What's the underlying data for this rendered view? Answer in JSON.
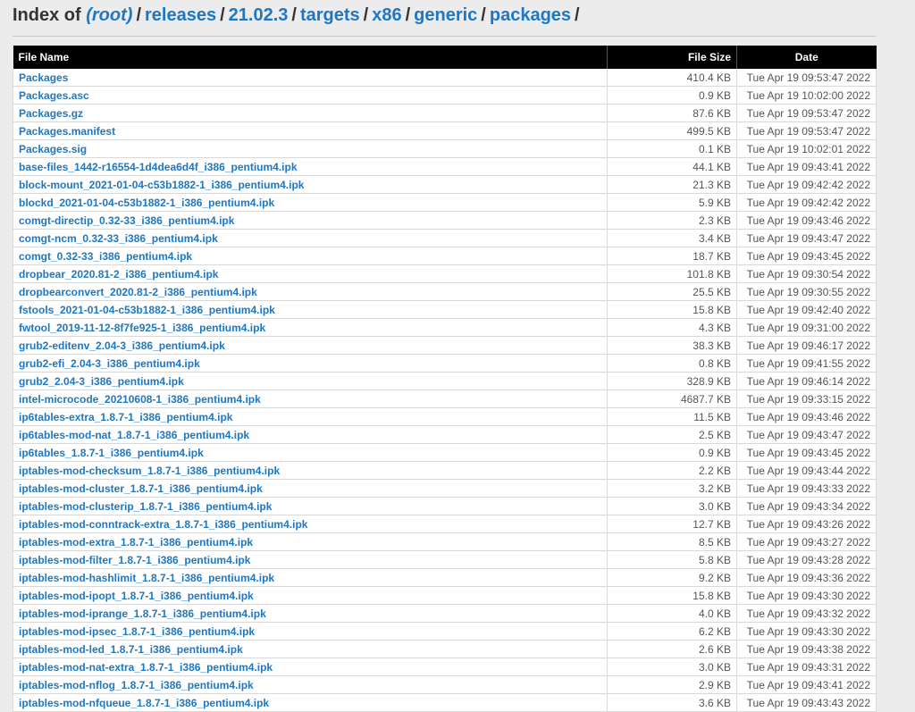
{
  "heading": {
    "prefix": "Index of ",
    "breadcrumb": [
      "(root)",
      "releases",
      "21.02.3",
      "targets",
      "x86",
      "generic",
      "packages"
    ],
    "trailing": "/"
  },
  "table": {
    "columns": [
      "File Name",
      "File Size",
      "Date"
    ],
    "rows": [
      {
        "name": "Packages",
        "size": "410.4 KB",
        "date": "Tue Apr 19 09:53:47 2022"
      },
      {
        "name": "Packages.asc",
        "size": "0.9 KB",
        "date": "Tue Apr 19 10:02:00 2022"
      },
      {
        "name": "Packages.gz",
        "size": "87.6 KB",
        "date": "Tue Apr 19 09:53:47 2022"
      },
      {
        "name": "Packages.manifest",
        "size": "499.5 KB",
        "date": "Tue Apr 19 09:53:47 2022"
      },
      {
        "name": "Packages.sig",
        "size": "0.1 KB",
        "date": "Tue Apr 19 10:02:01 2022"
      },
      {
        "name": "base-files_1442-r16554-1d4dea6d4f_i386_pentium4.ipk",
        "size": "44.1 KB",
        "date": "Tue Apr 19 09:43:41 2022"
      },
      {
        "name": "block-mount_2021-01-04-c53b1882-1_i386_pentium4.ipk",
        "size": "21.3 KB",
        "date": "Tue Apr 19 09:42:42 2022"
      },
      {
        "name": "blockd_2021-01-04-c53b1882-1_i386_pentium4.ipk",
        "size": "5.9 KB",
        "date": "Tue Apr 19 09:42:42 2022"
      },
      {
        "name": "comgt-directip_0.32-33_i386_pentium4.ipk",
        "size": "2.3 KB",
        "date": "Tue Apr 19 09:43:46 2022"
      },
      {
        "name": "comgt-ncm_0.32-33_i386_pentium4.ipk",
        "size": "3.4 KB",
        "date": "Tue Apr 19 09:43:47 2022"
      },
      {
        "name": "comgt_0.32-33_i386_pentium4.ipk",
        "size": "18.7 KB",
        "date": "Tue Apr 19 09:43:45 2022"
      },
      {
        "name": "dropbear_2020.81-2_i386_pentium4.ipk",
        "size": "101.8 KB",
        "date": "Tue Apr 19 09:30:54 2022"
      },
      {
        "name": "dropbearconvert_2020.81-2_i386_pentium4.ipk",
        "size": "25.5 KB",
        "date": "Tue Apr 19 09:30:55 2022"
      },
      {
        "name": "fstools_2021-01-04-c53b1882-1_i386_pentium4.ipk",
        "size": "15.8 KB",
        "date": "Tue Apr 19 09:42:40 2022"
      },
      {
        "name": "fwtool_2019-11-12-8f7fe925-1_i386_pentium4.ipk",
        "size": "4.3 KB",
        "date": "Tue Apr 19 09:31:00 2022"
      },
      {
        "name": "grub2-editenv_2.04-3_i386_pentium4.ipk",
        "size": "38.3 KB",
        "date": "Tue Apr 19 09:46:17 2022"
      },
      {
        "name": "grub2-efi_2.04-3_i386_pentium4.ipk",
        "size": "0.8 KB",
        "date": "Tue Apr 19 09:41:55 2022"
      },
      {
        "name": "grub2_2.04-3_i386_pentium4.ipk",
        "size": "328.9 KB",
        "date": "Tue Apr 19 09:46:14 2022"
      },
      {
        "name": "intel-microcode_20210608-1_i386_pentium4.ipk",
        "size": "4687.7 KB",
        "date": "Tue Apr 19 09:33:15 2022"
      },
      {
        "name": "ip6tables-extra_1.8.7-1_i386_pentium4.ipk",
        "size": "11.5 KB",
        "date": "Tue Apr 19 09:43:46 2022"
      },
      {
        "name": "ip6tables-mod-nat_1.8.7-1_i386_pentium4.ipk",
        "size": "2.5 KB",
        "date": "Tue Apr 19 09:43:47 2022"
      },
      {
        "name": "ip6tables_1.8.7-1_i386_pentium4.ipk",
        "size": "0.9 KB",
        "date": "Tue Apr 19 09:43:45 2022"
      },
      {
        "name": "iptables-mod-checksum_1.8.7-1_i386_pentium4.ipk",
        "size": "2.2 KB",
        "date": "Tue Apr 19 09:43:44 2022"
      },
      {
        "name": "iptables-mod-cluster_1.8.7-1_i386_pentium4.ipk",
        "size": "3.2 KB",
        "date": "Tue Apr 19 09:43:33 2022"
      },
      {
        "name": "iptables-mod-clusterip_1.8.7-1_i386_pentium4.ipk",
        "size": "3.0 KB",
        "date": "Tue Apr 19 09:43:34 2022"
      },
      {
        "name": "iptables-mod-conntrack-extra_1.8.7-1_i386_pentium4.ipk",
        "size": "12.7 KB",
        "date": "Tue Apr 19 09:43:26 2022"
      },
      {
        "name": "iptables-mod-extra_1.8.7-1_i386_pentium4.ipk",
        "size": "8.5 KB",
        "date": "Tue Apr 19 09:43:27 2022"
      },
      {
        "name": "iptables-mod-filter_1.8.7-1_i386_pentium4.ipk",
        "size": "5.8 KB",
        "date": "Tue Apr 19 09:43:28 2022"
      },
      {
        "name": "iptables-mod-hashlimit_1.8.7-1_i386_pentium4.ipk",
        "size": "9.2 KB",
        "date": "Tue Apr 19 09:43:36 2022"
      },
      {
        "name": "iptables-mod-ipopt_1.8.7-1_i386_pentium4.ipk",
        "size": "15.8 KB",
        "date": "Tue Apr 19 09:43:30 2022"
      },
      {
        "name": "iptables-mod-iprange_1.8.7-1_i386_pentium4.ipk",
        "size": "4.0 KB",
        "date": "Tue Apr 19 09:43:32 2022"
      },
      {
        "name": "iptables-mod-ipsec_1.8.7-1_i386_pentium4.ipk",
        "size": "6.2 KB",
        "date": "Tue Apr 19 09:43:30 2022"
      },
      {
        "name": "iptables-mod-led_1.8.7-1_i386_pentium4.ipk",
        "size": "2.6 KB",
        "date": "Tue Apr 19 09:43:38 2022"
      },
      {
        "name": "iptables-mod-nat-extra_1.8.7-1_i386_pentium4.ipk",
        "size": "3.0 KB",
        "date": "Tue Apr 19 09:43:31 2022"
      },
      {
        "name": "iptables-mod-nflog_1.8.7-1_i386_pentium4.ipk",
        "size": "2.9 KB",
        "date": "Tue Apr 19 09:43:41 2022"
      },
      {
        "name": "iptables-mod-nfqueue_1.8.7-1_i386_pentium4.ipk",
        "size": "3.6 KB",
        "date": "Tue Apr 19 09:43:43 2022"
      }
    ]
  }
}
